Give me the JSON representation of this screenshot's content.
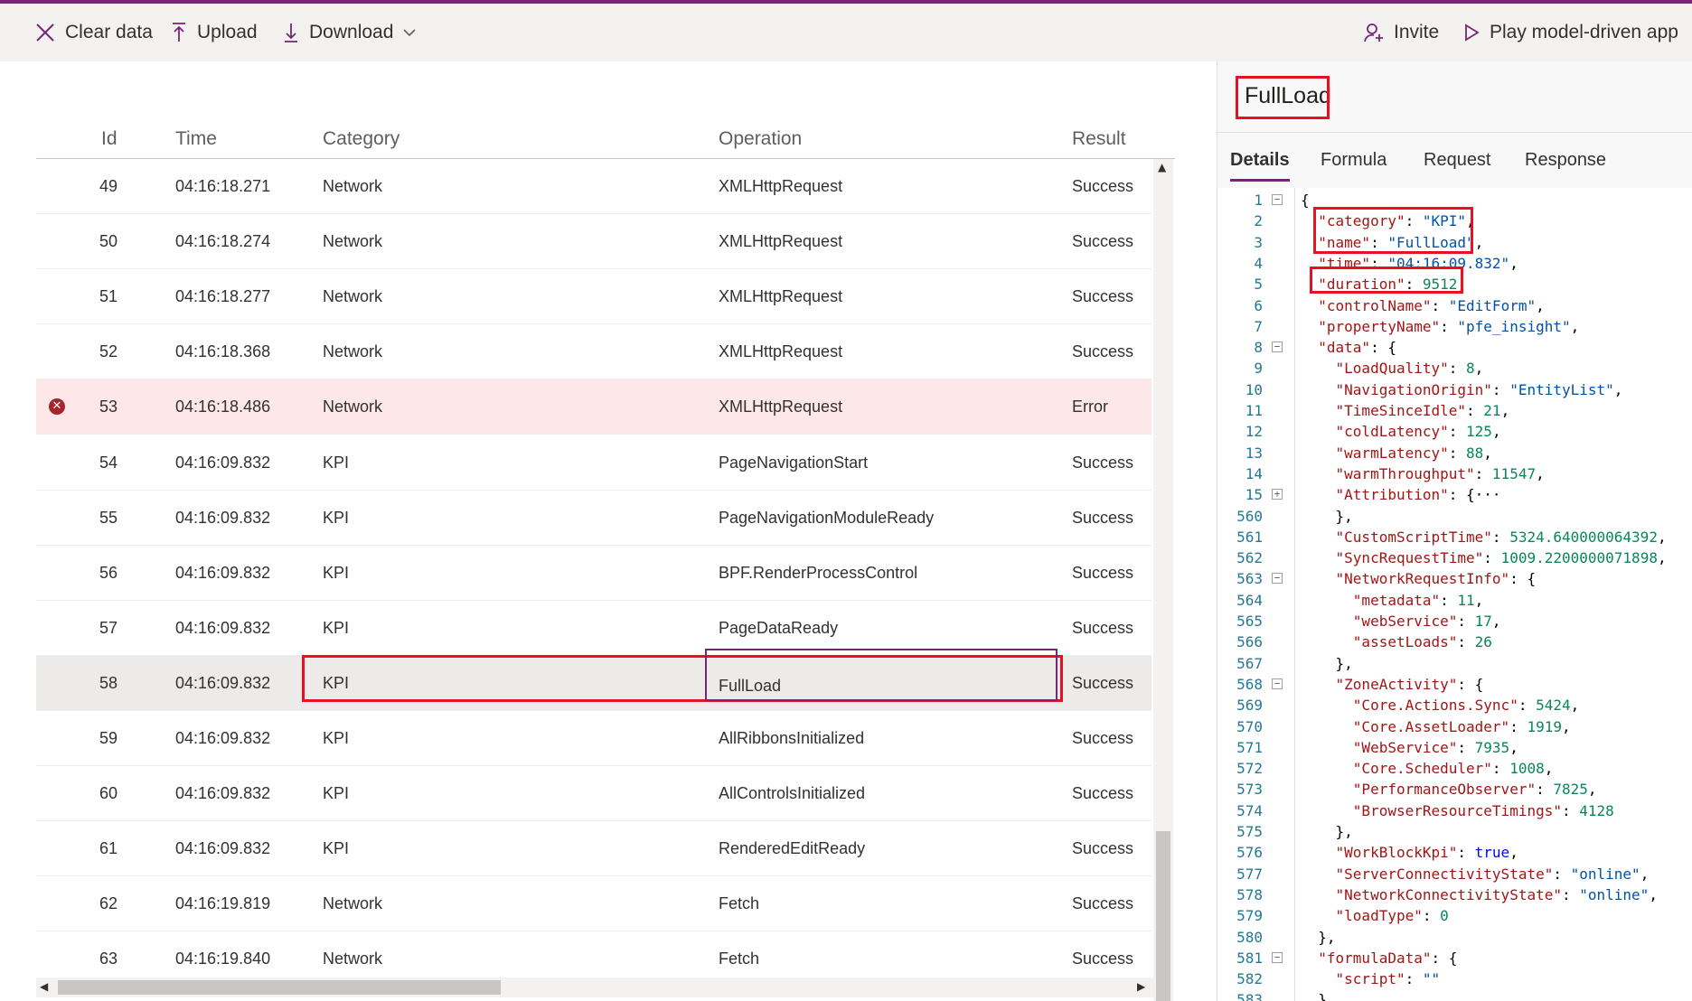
{
  "toolbar": {
    "clear_label": "Clear data",
    "upload_label": "Upload",
    "download_label": "Download",
    "invite_label": "Invite",
    "play_label": "Play model-driven app"
  },
  "grid": {
    "columns": [
      "Id",
      "Time",
      "Category",
      "Operation",
      "Result"
    ],
    "rows": [
      {
        "id": "49",
        "time": "04:16:18.271",
        "category": "Network",
        "operation": "XMLHttpRequest",
        "result": "Success"
      },
      {
        "id": "50",
        "time": "04:16:18.274",
        "category": "Network",
        "operation": "XMLHttpRequest",
        "result": "Success"
      },
      {
        "id": "51",
        "time": "04:16:18.277",
        "category": "Network",
        "operation": "XMLHttpRequest",
        "result": "Success"
      },
      {
        "id": "52",
        "time": "04:16:18.368",
        "category": "Network",
        "operation": "XMLHttpRequest",
        "result": "Success"
      },
      {
        "id": "53",
        "time": "04:16:18.486",
        "category": "Network",
        "operation": "XMLHttpRequest",
        "result": "Error"
      },
      {
        "id": "54",
        "time": "04:16:09.832",
        "category": "KPI",
        "operation": "PageNavigationStart",
        "result": "Success"
      },
      {
        "id": "55",
        "time": "04:16:09.832",
        "category": "KPI",
        "operation": "PageNavigationModuleReady",
        "result": "Success"
      },
      {
        "id": "56",
        "time": "04:16:09.832",
        "category": "KPI",
        "operation": "BPF.RenderProcessControl",
        "result": "Success"
      },
      {
        "id": "57",
        "time": "04:16:09.832",
        "category": "KPI",
        "operation": "PageDataReady",
        "result": "Success"
      },
      {
        "id": "58",
        "time": "04:16:09.832",
        "category": "KPI",
        "operation": "FullLoad",
        "result": "Success"
      },
      {
        "id": "59",
        "time": "04:16:09.832",
        "category": "KPI",
        "operation": "AllRibbonsInitialized",
        "result": "Success"
      },
      {
        "id": "60",
        "time": "04:16:09.832",
        "category": "KPI",
        "operation": "AllControlsInitialized",
        "result": "Success"
      },
      {
        "id": "61",
        "time": "04:16:09.832",
        "category": "KPI",
        "operation": "RenderedEditReady",
        "result": "Success"
      },
      {
        "id": "62",
        "time": "04:16:19.819",
        "category": "Network",
        "operation": "Fetch",
        "result": "Success"
      },
      {
        "id": "63",
        "time": "04:16:19.840",
        "category": "Network",
        "operation": "Fetch",
        "result": "Success"
      }
    ],
    "error_row_index": 4,
    "selected_row_index": 9
  },
  "panel": {
    "title": "FullLoad",
    "tabs": [
      "Details",
      "Formula",
      "Request",
      "Response"
    ],
    "active_tab": "Details"
  },
  "code_lines": [
    {
      "n": "1",
      "fold": "minus",
      "parts": [
        [
          "p",
          "{"
        ]
      ]
    },
    {
      "n": "2",
      "parts": [
        [
          "p",
          "  "
        ],
        [
          "k",
          "\"category\""
        ],
        [
          "p",
          ": "
        ],
        [
          "s",
          "\"KPI\""
        ],
        [
          "p",
          ","
        ]
      ]
    },
    {
      "n": "3",
      "parts": [
        [
          "p",
          "  "
        ],
        [
          "k",
          "\"name\""
        ],
        [
          "p",
          ": "
        ],
        [
          "s",
          "\"FullLoad\""
        ],
        [
          "p",
          ","
        ]
      ]
    },
    {
      "n": "4",
      "parts": [
        [
          "p",
          "  "
        ],
        [
          "k",
          "\"time\""
        ],
        [
          "p",
          ": "
        ],
        [
          "s",
          "\"04:16:09.832\""
        ],
        [
          "p",
          ","
        ]
      ]
    },
    {
      "n": "5",
      "parts": [
        [
          "p",
          "  "
        ],
        [
          "k",
          "\"duration\""
        ],
        [
          "p",
          ": "
        ],
        [
          "n",
          "9512"
        ],
        [
          "p",
          ","
        ]
      ]
    },
    {
      "n": "6",
      "parts": [
        [
          "p",
          "  "
        ],
        [
          "k",
          "\"controlName\""
        ],
        [
          "p",
          ": "
        ],
        [
          "s",
          "\"EditForm\""
        ],
        [
          "p",
          ","
        ]
      ]
    },
    {
      "n": "7",
      "parts": [
        [
          "p",
          "  "
        ],
        [
          "k",
          "\"propertyName\""
        ],
        [
          "p",
          ": "
        ],
        [
          "s",
          "\"pfe_insight\""
        ],
        [
          "p",
          ","
        ]
      ]
    },
    {
      "n": "8",
      "fold": "minus",
      "parts": [
        [
          "p",
          "  "
        ],
        [
          "k",
          "\"data\""
        ],
        [
          "p",
          ": {"
        ]
      ]
    },
    {
      "n": "9",
      "parts": [
        [
          "p",
          "    "
        ],
        [
          "k",
          "\"LoadQuality\""
        ],
        [
          "p",
          ": "
        ],
        [
          "n",
          "8"
        ],
        [
          "p",
          ","
        ]
      ]
    },
    {
      "n": "10",
      "parts": [
        [
          "p",
          "    "
        ],
        [
          "k",
          "\"NavigationOrigin\""
        ],
        [
          "p",
          ": "
        ],
        [
          "s",
          "\"EntityList\""
        ],
        [
          "p",
          ","
        ]
      ]
    },
    {
      "n": "11",
      "parts": [
        [
          "p",
          "    "
        ],
        [
          "k",
          "\"TimeSinceIdle\""
        ],
        [
          "p",
          ": "
        ],
        [
          "n",
          "21"
        ],
        [
          "p",
          ","
        ]
      ]
    },
    {
      "n": "12",
      "parts": [
        [
          "p",
          "    "
        ],
        [
          "k",
          "\"coldLatency\""
        ],
        [
          "p",
          ": "
        ],
        [
          "n",
          "125"
        ],
        [
          "p",
          ","
        ]
      ]
    },
    {
      "n": "13",
      "parts": [
        [
          "p",
          "    "
        ],
        [
          "k",
          "\"warmLatency\""
        ],
        [
          "p",
          ": "
        ],
        [
          "n",
          "88"
        ],
        [
          "p",
          ","
        ]
      ]
    },
    {
      "n": "14",
      "parts": [
        [
          "p",
          "    "
        ],
        [
          "k",
          "\"warmThroughput\""
        ],
        [
          "p",
          ": "
        ],
        [
          "n",
          "11547"
        ],
        [
          "p",
          ","
        ]
      ]
    },
    {
      "n": "15",
      "fold": "plus",
      "parts": [
        [
          "p",
          "    "
        ],
        [
          "k",
          "\"Attribution\""
        ],
        [
          "p",
          ": {···"
        ]
      ]
    },
    {
      "n": "560",
      "parts": [
        [
          "p",
          "    },"
        ]
      ]
    },
    {
      "n": "561",
      "parts": [
        [
          "p",
          "    "
        ],
        [
          "k",
          "\"CustomScriptTime\""
        ],
        [
          "p",
          ": "
        ],
        [
          "n",
          "5324.640000064392"
        ],
        [
          "p",
          ","
        ]
      ]
    },
    {
      "n": "562",
      "parts": [
        [
          "p",
          "    "
        ],
        [
          "k",
          "\"SyncRequestTime\""
        ],
        [
          "p",
          ": "
        ],
        [
          "n",
          "1009.2200000071898"
        ],
        [
          "p",
          ","
        ]
      ]
    },
    {
      "n": "563",
      "fold": "minus",
      "parts": [
        [
          "p",
          "    "
        ],
        [
          "k",
          "\"NetworkRequestInfo\""
        ],
        [
          "p",
          ": {"
        ]
      ]
    },
    {
      "n": "564",
      "parts": [
        [
          "p",
          "      "
        ],
        [
          "k",
          "\"metadata\""
        ],
        [
          "p",
          ": "
        ],
        [
          "n",
          "11"
        ],
        [
          "p",
          ","
        ]
      ]
    },
    {
      "n": "565",
      "parts": [
        [
          "p",
          "      "
        ],
        [
          "k",
          "\"webService\""
        ],
        [
          "p",
          ": "
        ],
        [
          "n",
          "17"
        ],
        [
          "p",
          ","
        ]
      ]
    },
    {
      "n": "566",
      "parts": [
        [
          "p",
          "      "
        ],
        [
          "k",
          "\"assetLoads\""
        ],
        [
          "p",
          ": "
        ],
        [
          "n",
          "26"
        ]
      ]
    },
    {
      "n": "567",
      "parts": [
        [
          "p",
          "    },"
        ]
      ]
    },
    {
      "n": "568",
      "fold": "minus",
      "parts": [
        [
          "p",
          "    "
        ],
        [
          "k",
          "\"ZoneActivity\""
        ],
        [
          "p",
          ": {"
        ]
      ]
    },
    {
      "n": "569",
      "parts": [
        [
          "p",
          "      "
        ],
        [
          "k",
          "\"Core.Actions.Sync\""
        ],
        [
          "p",
          ": "
        ],
        [
          "n",
          "5424"
        ],
        [
          "p",
          ","
        ]
      ]
    },
    {
      "n": "570",
      "parts": [
        [
          "p",
          "      "
        ],
        [
          "k",
          "\"Core.AssetLoader\""
        ],
        [
          "p",
          ": "
        ],
        [
          "n",
          "1919"
        ],
        [
          "p",
          ","
        ]
      ]
    },
    {
      "n": "571",
      "parts": [
        [
          "p",
          "      "
        ],
        [
          "k",
          "\"WebService\""
        ],
        [
          "p",
          ": "
        ],
        [
          "n",
          "7935"
        ],
        [
          "p",
          ","
        ]
      ]
    },
    {
      "n": "572",
      "parts": [
        [
          "p",
          "      "
        ],
        [
          "k",
          "\"Core.Scheduler\""
        ],
        [
          "p",
          ": "
        ],
        [
          "n",
          "1008"
        ],
        [
          "p",
          ","
        ]
      ]
    },
    {
      "n": "573",
      "parts": [
        [
          "p",
          "      "
        ],
        [
          "k",
          "\"PerformanceObserver\""
        ],
        [
          "p",
          ": "
        ],
        [
          "n",
          "7825"
        ],
        [
          "p",
          ","
        ]
      ]
    },
    {
      "n": "574",
      "parts": [
        [
          "p",
          "      "
        ],
        [
          "k",
          "\"BrowserResourceTimings\""
        ],
        [
          "p",
          ": "
        ],
        [
          "n",
          "4128"
        ]
      ]
    },
    {
      "n": "575",
      "parts": [
        [
          "p",
          "    },"
        ]
      ]
    },
    {
      "n": "576",
      "parts": [
        [
          "p",
          "    "
        ],
        [
          "k",
          "\"WorkBlockKpi\""
        ],
        [
          "p",
          ": "
        ],
        [
          "b",
          "true"
        ],
        [
          "p",
          ","
        ]
      ]
    },
    {
      "n": "577",
      "parts": [
        [
          "p",
          "    "
        ],
        [
          "k",
          "\"ServerConnectivityState\""
        ],
        [
          "p",
          ": "
        ],
        [
          "s",
          "\"online\""
        ],
        [
          "p",
          ","
        ]
      ]
    },
    {
      "n": "578",
      "parts": [
        [
          "p",
          "    "
        ],
        [
          "k",
          "\"NetworkConnectivityState\""
        ],
        [
          "p",
          ": "
        ],
        [
          "s",
          "\"online\""
        ],
        [
          "p",
          ","
        ]
      ]
    },
    {
      "n": "579",
      "parts": [
        [
          "p",
          "    "
        ],
        [
          "k",
          "\"loadType\""
        ],
        [
          "p",
          ": "
        ],
        [
          "n",
          "0"
        ]
      ]
    },
    {
      "n": "580",
      "parts": [
        [
          "p",
          "  },"
        ]
      ]
    },
    {
      "n": "581",
      "fold": "minus",
      "parts": [
        [
          "p",
          "  "
        ],
        [
          "k",
          "\"formulaData\""
        ],
        [
          "p",
          ": {"
        ]
      ]
    },
    {
      "n": "582",
      "parts": [
        [
          "p",
          "    "
        ],
        [
          "k",
          "\"script\""
        ],
        [
          "p",
          ": "
        ],
        [
          "s",
          "\"\""
        ]
      ]
    },
    {
      "n": "583",
      "parts": [
        [
          "p",
          "  }"
        ]
      ]
    }
  ],
  "colors": {
    "accent": "#742774",
    "highlight": "#e81123",
    "error_row": "#fde7e9",
    "error_icon": "#a4262c"
  }
}
